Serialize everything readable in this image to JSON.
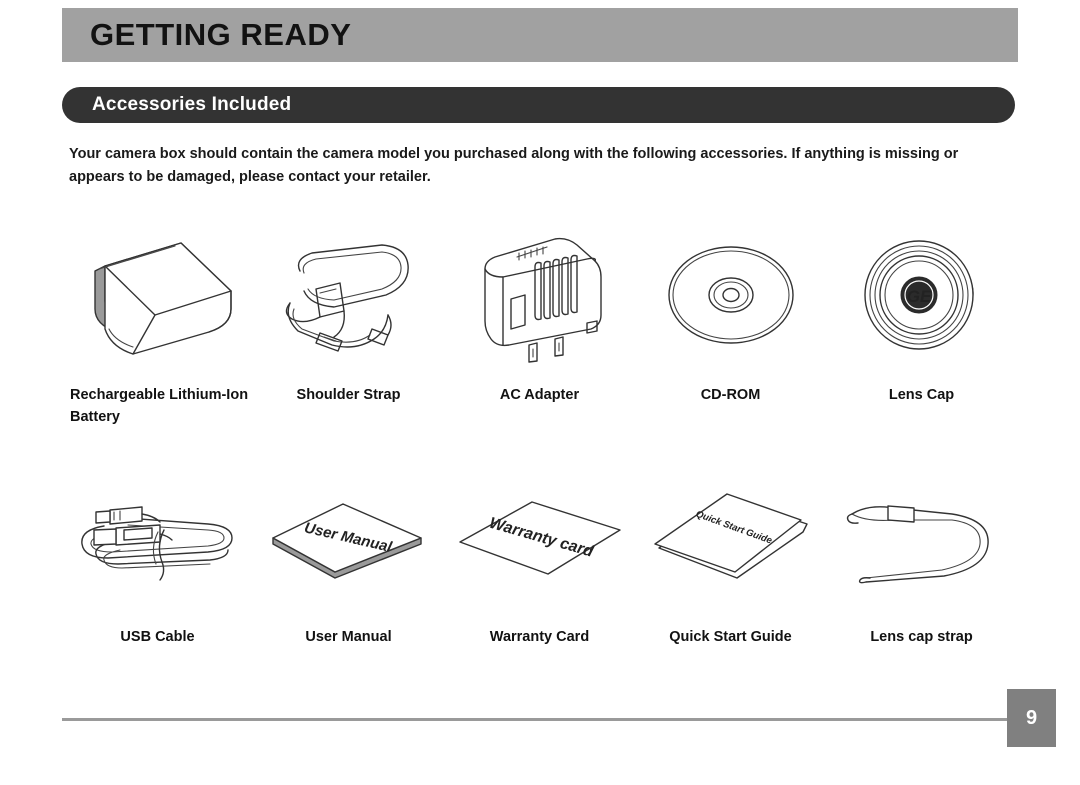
{
  "header": {
    "title": "GETTING READY",
    "band_color": "#a1a1a1"
  },
  "section": {
    "title": "Accessories Included",
    "bar_color": "#333333"
  },
  "intro": {
    "text": "Your camera box should contain the camera model you purchased along with the following accessories. If anything is missing or appears to be damaged, please contact your retailer."
  },
  "accessories": {
    "row1": [
      {
        "caption": "Rechargeable Lithium-Ion Battery",
        "icon": "battery-icon"
      },
      {
        "caption": "Shoulder Strap",
        "icon": "shoulder-strap-icon"
      },
      {
        "caption": "AC Adapter",
        "icon": "ac-adapter-icon"
      },
      {
        "caption": "CD-ROM",
        "icon": "cd-rom-icon"
      },
      {
        "caption": "Lens Cap",
        "icon": "lens-cap-icon"
      }
    ],
    "row2": [
      {
        "caption": "USB Cable",
        "icon": "usb-cable-icon"
      },
      {
        "caption": "User Manual",
        "icon": "user-manual-icon",
        "art_label": "User Manual"
      },
      {
        "caption": "Warranty Card",
        "icon": "warranty-card-icon",
        "art_label": "Warranty card"
      },
      {
        "caption": "Quick Start Guide",
        "icon": "quick-start-guide-icon",
        "art_label": "Quick Start Guide"
      },
      {
        "caption": "Lens cap strap",
        "icon": "lens-cap-strap-icon"
      }
    ]
  },
  "lens_cap": {
    "logo_text": "GE"
  },
  "footer": {
    "page_number": "9",
    "box_color": "#808080",
    "rule_color": "#9a9a9a"
  }
}
